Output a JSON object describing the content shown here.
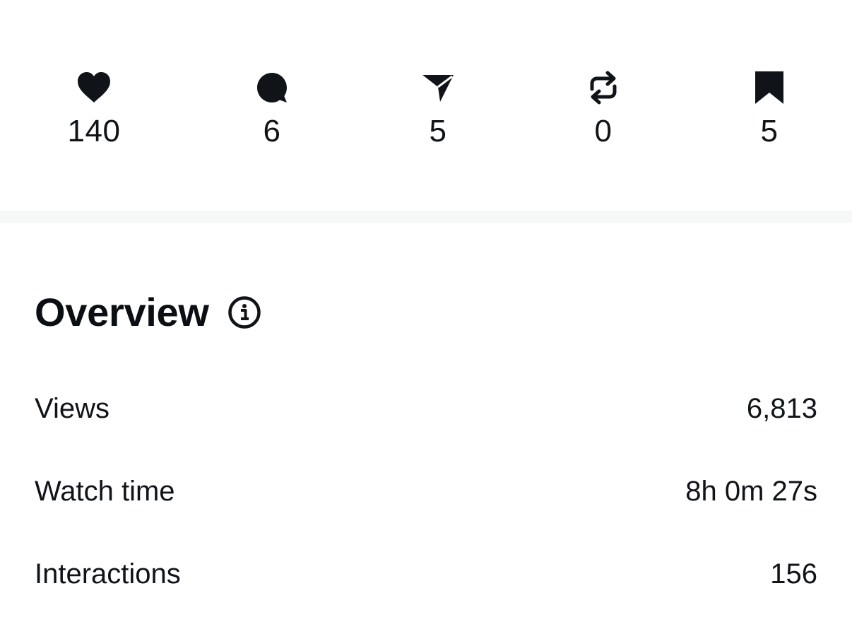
{
  "stats": [
    {
      "key": "likes",
      "icon": "heart-icon",
      "count": "140"
    },
    {
      "key": "comments",
      "icon": "comment-icon",
      "count": "6"
    },
    {
      "key": "shares",
      "icon": "send-icon",
      "count": "5"
    },
    {
      "key": "reposts",
      "icon": "repost-icon",
      "count": "0"
    },
    {
      "key": "saves",
      "icon": "bookmark-icon",
      "count": "5"
    }
  ],
  "overview": {
    "title": "Overview",
    "info_icon": "info-icon",
    "metrics": [
      {
        "label": "Views",
        "value": "6,813"
      },
      {
        "label": "Watch time",
        "value": "8h 0m 27s"
      },
      {
        "label": "Interactions",
        "value": "156"
      }
    ]
  },
  "colors": {
    "text": "#101418",
    "divider": "#f6f7f7",
    "background": "#ffffff"
  }
}
